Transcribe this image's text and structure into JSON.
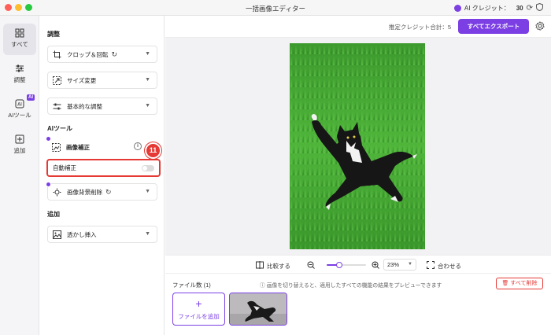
{
  "window": {
    "title": "一括画像エディター"
  },
  "credit": {
    "label": "AI クレジット：",
    "value": "30"
  },
  "rail": {
    "items": [
      {
        "label": "すべて",
        "icon": "grid-icon",
        "active": true
      },
      {
        "label": "調整",
        "icon": "sliders-icon",
        "active": false
      },
      {
        "label": "AIツール",
        "icon": "ai-icon",
        "badge": "AI",
        "active": false
      },
      {
        "label": "追加",
        "icon": "add-box-icon",
        "active": false
      }
    ]
  },
  "panel": {
    "adjust_title": "調整",
    "crop_label": "クロップ＆回転",
    "resize_label": "サイズ変更",
    "basic_label": "基本的な調整",
    "ai_title": "AIツール",
    "enhance_label": "画像補正",
    "auto_label": "自動補正",
    "bg_remove_label": "画像背景削除",
    "add_title": "追加",
    "watermark_label": "透かし挿入"
  },
  "step_badge": "11",
  "header": {
    "estimate": "推定クレジット合計：",
    "estimate_value": "5",
    "export_label": "すべてエクスポート"
  },
  "zoombar": {
    "compare_label": "比較する",
    "zoom_value": "23%",
    "fit_label": "合わせる",
    "zoom_level": 0.23
  },
  "files": {
    "count_label": "ファイル数 (1)",
    "hint": "画像を切り替えると、適用したすべての機能の結果をプレビューできます",
    "delete_all_label": "すべて削除",
    "add_file_label": "ファイルを追加"
  },
  "colors": {
    "accent": "#7b3fe4",
    "danger": "#e53935"
  }
}
